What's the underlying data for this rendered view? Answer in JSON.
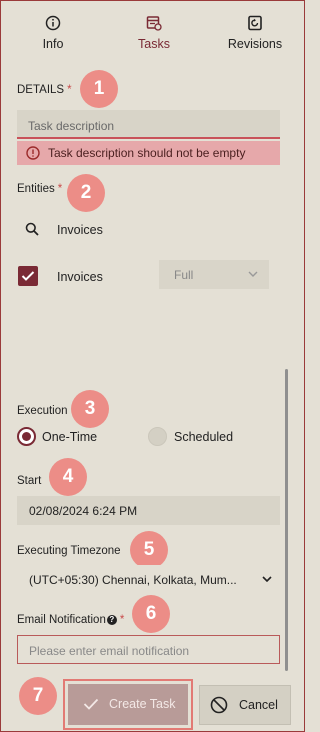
{
  "tabs": [
    {
      "label": "Info",
      "icon": "info-icon"
    },
    {
      "label": "Tasks",
      "icon": "tasks-icon",
      "active": true
    },
    {
      "label": "Revisions",
      "icon": "revisions-icon"
    }
  ],
  "badges": [
    "1",
    "2",
    "3",
    "4",
    "5",
    "6",
    "7"
  ],
  "details": {
    "label": "DETAILS",
    "required_mark": "*",
    "description_placeholder": "Task description",
    "error": "Task description should not be empty"
  },
  "entities": {
    "label": "Entities",
    "required_mark": "*",
    "search_value": "Invoices",
    "items": [
      {
        "name": "Invoices",
        "checked": true,
        "permission": "Full"
      }
    ]
  },
  "execution": {
    "label": "Execution",
    "options": [
      "One-Time",
      "Scheduled"
    ],
    "selected": "One-Time"
  },
  "start": {
    "label": "Start",
    "value": "02/08/2024 6:24 PM"
  },
  "timezone": {
    "label": "Executing Timezone",
    "value": "(UTC+05:30) Chennai, Kolkata, Mum..."
  },
  "email": {
    "label": "Email Notification",
    "help": "?",
    "required_mark": "*",
    "placeholder": "Please enter email notification"
  },
  "actions": {
    "create": "Create Task",
    "cancel": "Cancel"
  },
  "colors": {
    "accent": "#7a2a35",
    "badge": "#ec8d87",
    "error_bg": "#e6a8aa",
    "background": "#e4e0d5"
  }
}
